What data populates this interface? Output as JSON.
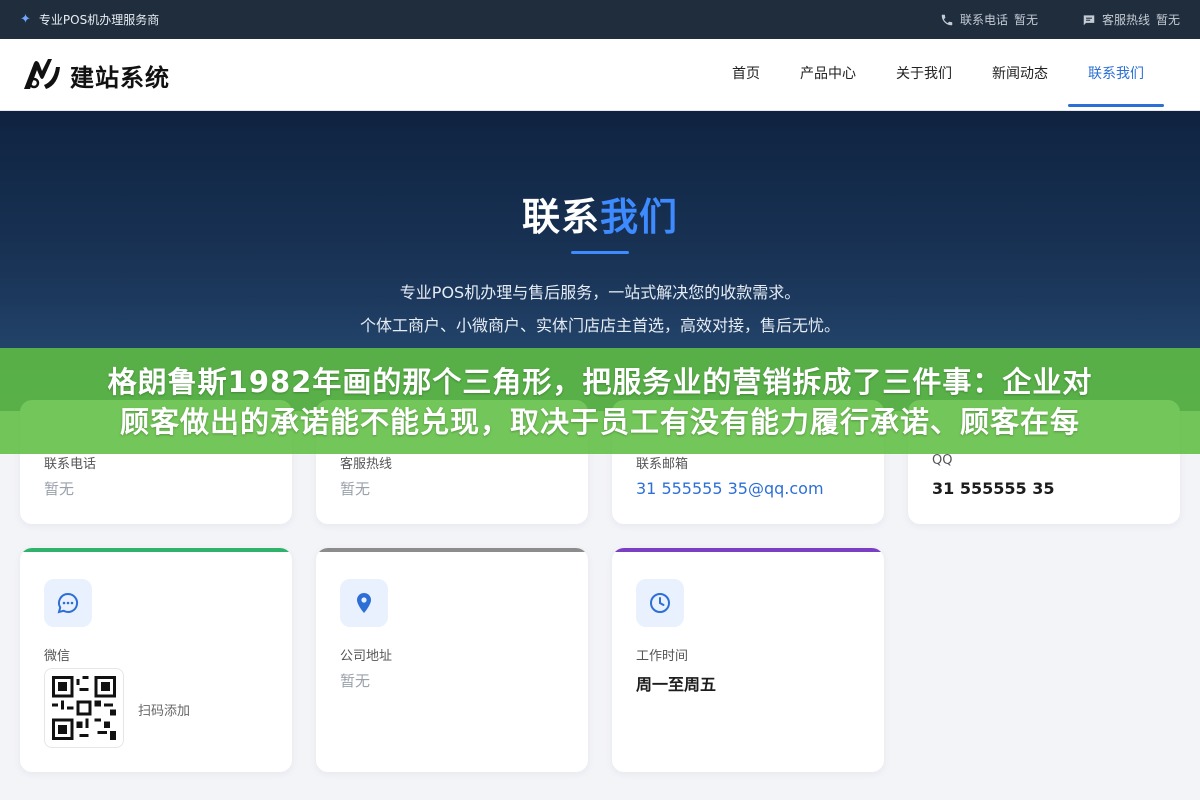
{
  "topbar": {
    "brand": "专业POS机办理服务商",
    "phone_label": "联系电话",
    "phone_value": "暂无",
    "hotline_label": "客服热线",
    "hotline_value": "暂无"
  },
  "header": {
    "logo_text": "建站系统",
    "nav": [
      {
        "label": "首页",
        "active": false
      },
      {
        "label": "产品中心",
        "active": false
      },
      {
        "label": "关于我们",
        "active": false
      },
      {
        "label": "新闻动态",
        "active": false
      },
      {
        "label": "联系我们",
        "active": true
      }
    ]
  },
  "hero": {
    "title_part1": "联系",
    "title_part2": "我们",
    "line1": "专业POS机办理与售后服务，一站式解决您的收款需求。",
    "line2": "个体工商户、小微商户、实体门店店主首选，高效对接，售后无忧。"
  },
  "banner": {
    "line1": "格朗鲁斯1982年画的那个三角形，把服务业的营销拆成了三件事：企业对",
    "line2": "顾客做出的承诺能不能兑现，取决于员工有没有能力履行承诺、顾客在每"
  },
  "cards": {
    "phone": {
      "label": "联系电话",
      "value": "暂无"
    },
    "hotline": {
      "label": "客服热线",
      "value": "暂无"
    },
    "email": {
      "label": "联系邮箱",
      "value": "31 555555 35@qq.com"
    },
    "qq": {
      "label": "QQ",
      "value": "31 555555 35"
    },
    "wechat": {
      "label": "微信",
      "hint": "扫码添加",
      "icon": "chat-icon",
      "accent": "#2fb36a"
    },
    "address": {
      "label": "公司地址",
      "value": "暂无",
      "icon": "location-pin-icon",
      "accent": "#8c8c8c"
    },
    "hours": {
      "label": "工作时间",
      "value": "周一至周五",
      "icon": "clock-icon",
      "accent": "#7b3fc4"
    }
  },
  "colors": {
    "primary": "#2d6fd6",
    "topbar_bg": "#1f2d3d",
    "banner_green": "#60be42"
  }
}
